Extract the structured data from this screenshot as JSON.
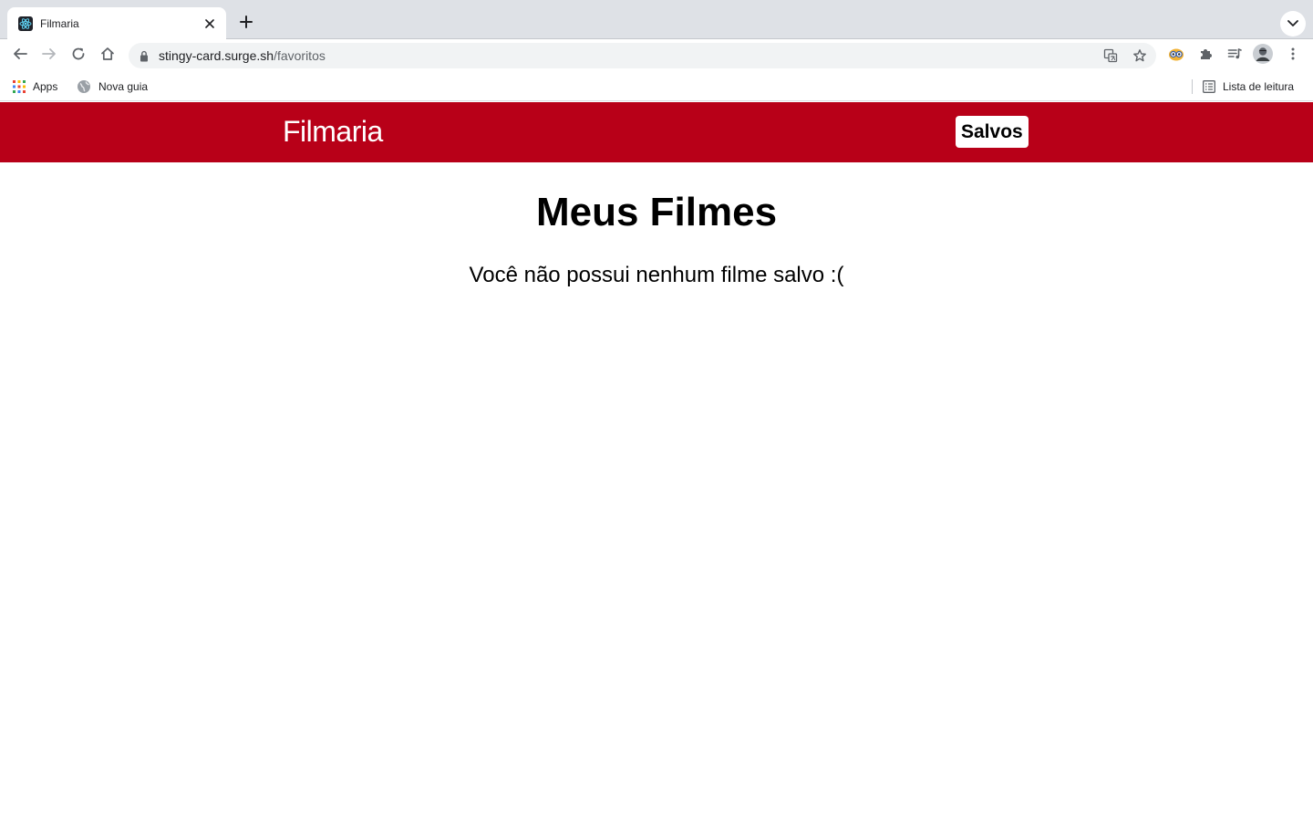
{
  "browser": {
    "tab": {
      "title": "Filmaria",
      "favicon": "react-icon"
    },
    "address": {
      "host": "stingy-card.surge.sh",
      "path": "/favoritos"
    },
    "bookmarks": {
      "apps_label": "Apps",
      "items": [
        {
          "label": "Nova guia",
          "icon": "globe-icon"
        }
      ],
      "reading_list_label": "Lista de leitura"
    }
  },
  "site": {
    "brand": "Filmaria",
    "nav": {
      "saved_label": "Salvos"
    },
    "title": "Meus Filmes",
    "empty_message": "Você não possui nenhum filme salvo :("
  },
  "colors": {
    "header_bg": "#b80018",
    "header_text": "#ffffff",
    "saved_button_bg": "#ffffff"
  }
}
